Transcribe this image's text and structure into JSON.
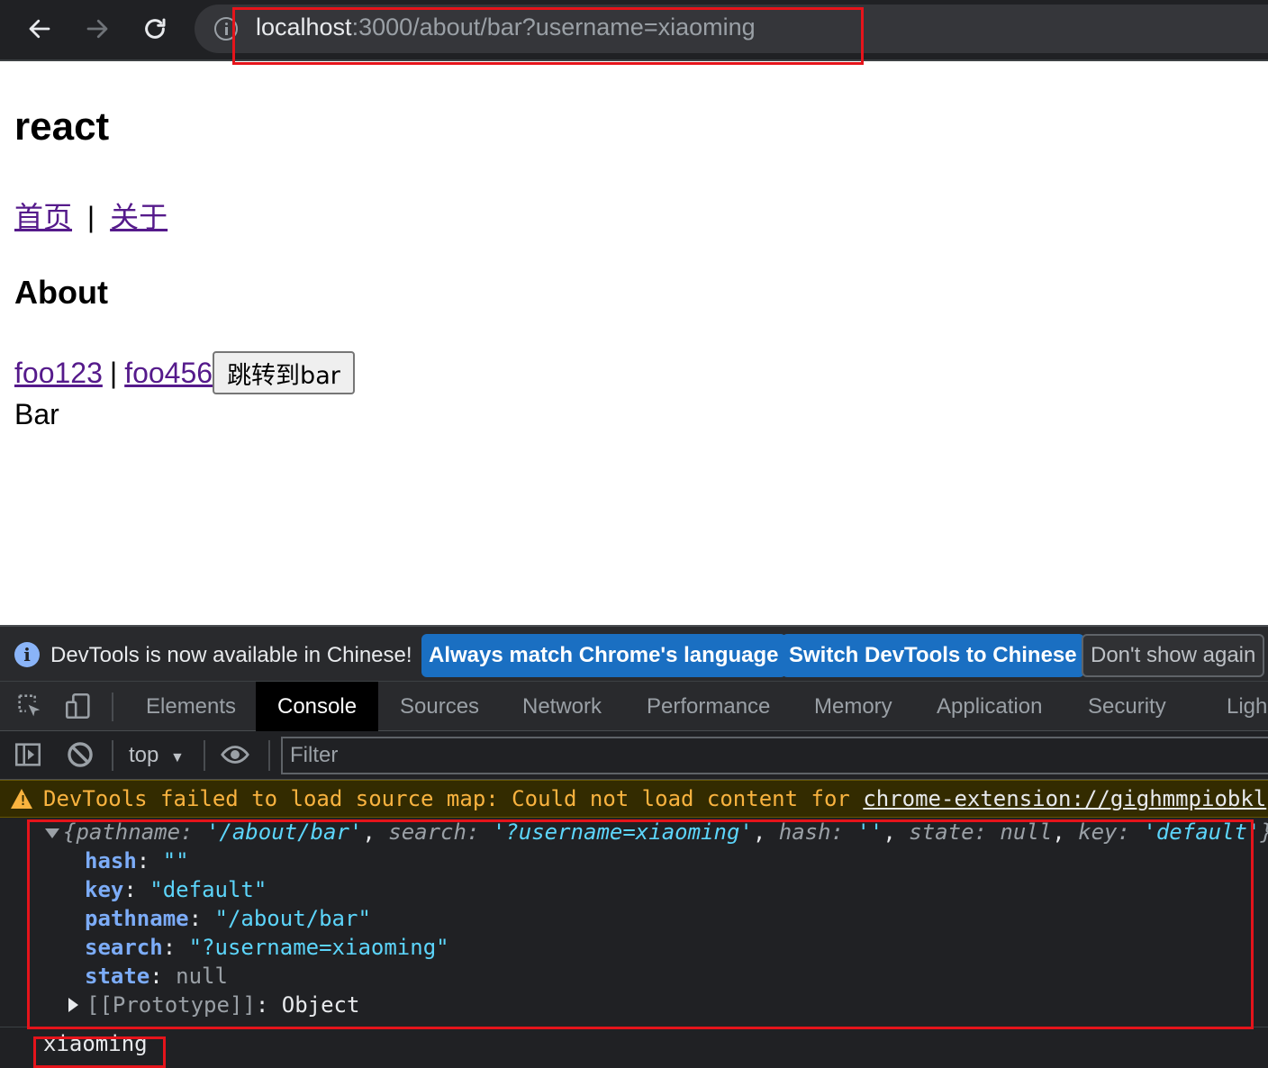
{
  "browser": {
    "url_host": "localhost",
    "url_path": ":3000/about/bar?username=xiaoming"
  },
  "page": {
    "title": "react",
    "nav": {
      "home": "首页",
      "separator": "|",
      "about": "关于"
    },
    "section_title": "About",
    "subnav": {
      "foo123": "foo123",
      "separator": "|",
      "foo456": "foo456",
      "jump_button": "跳转到bar"
    },
    "content": "Bar"
  },
  "devtools": {
    "infobar": {
      "message": "DevTools is now available in Chinese!",
      "always_match": "Always match Chrome's language",
      "switch": "Switch DevTools to Chinese",
      "dont_show": "Don't show again"
    },
    "tabs": [
      "Elements",
      "Console",
      "Sources",
      "Network",
      "Performance",
      "Memory",
      "Application",
      "Security",
      "Ligh"
    ],
    "active_tab": "Console",
    "context": "top",
    "filter_placeholder": "Filter",
    "warning": {
      "text": "DevTools failed to load source map: Could not load content for ",
      "link": "chrome-extension://gighmmpiobkl"
    },
    "log_object": {
      "summary": {
        "open": "{",
        "k1": "pathname",
        "v1": "'/about/bar'",
        "k2": "search",
        "v2": "'?username=xiaoming'",
        "k3": "hash",
        "v3": "''",
        "k4": "state",
        "v4": "null",
        "k5": "key",
        "v5": "'default'",
        "close": "}"
      },
      "props": [
        {
          "key": "hash",
          "value": "\"\""
        },
        {
          "key": "key",
          "value": "\"default\""
        },
        {
          "key": "pathname",
          "value": "\"/about/bar\""
        },
        {
          "key": "search",
          "value": "\"?username=xiaoming\""
        },
        {
          "key": "state",
          "value": "null"
        }
      ],
      "prototype_label": "[[Prototype]]",
      "prototype_value": "Object"
    },
    "log_output": "xiaoming"
  },
  "colors": {
    "highlight_box": "#e5141b",
    "link": "#551a8b",
    "devtools_bg": "#202124",
    "infobar_button": "#1a6fc2",
    "warning_text": "#f9b33f"
  }
}
